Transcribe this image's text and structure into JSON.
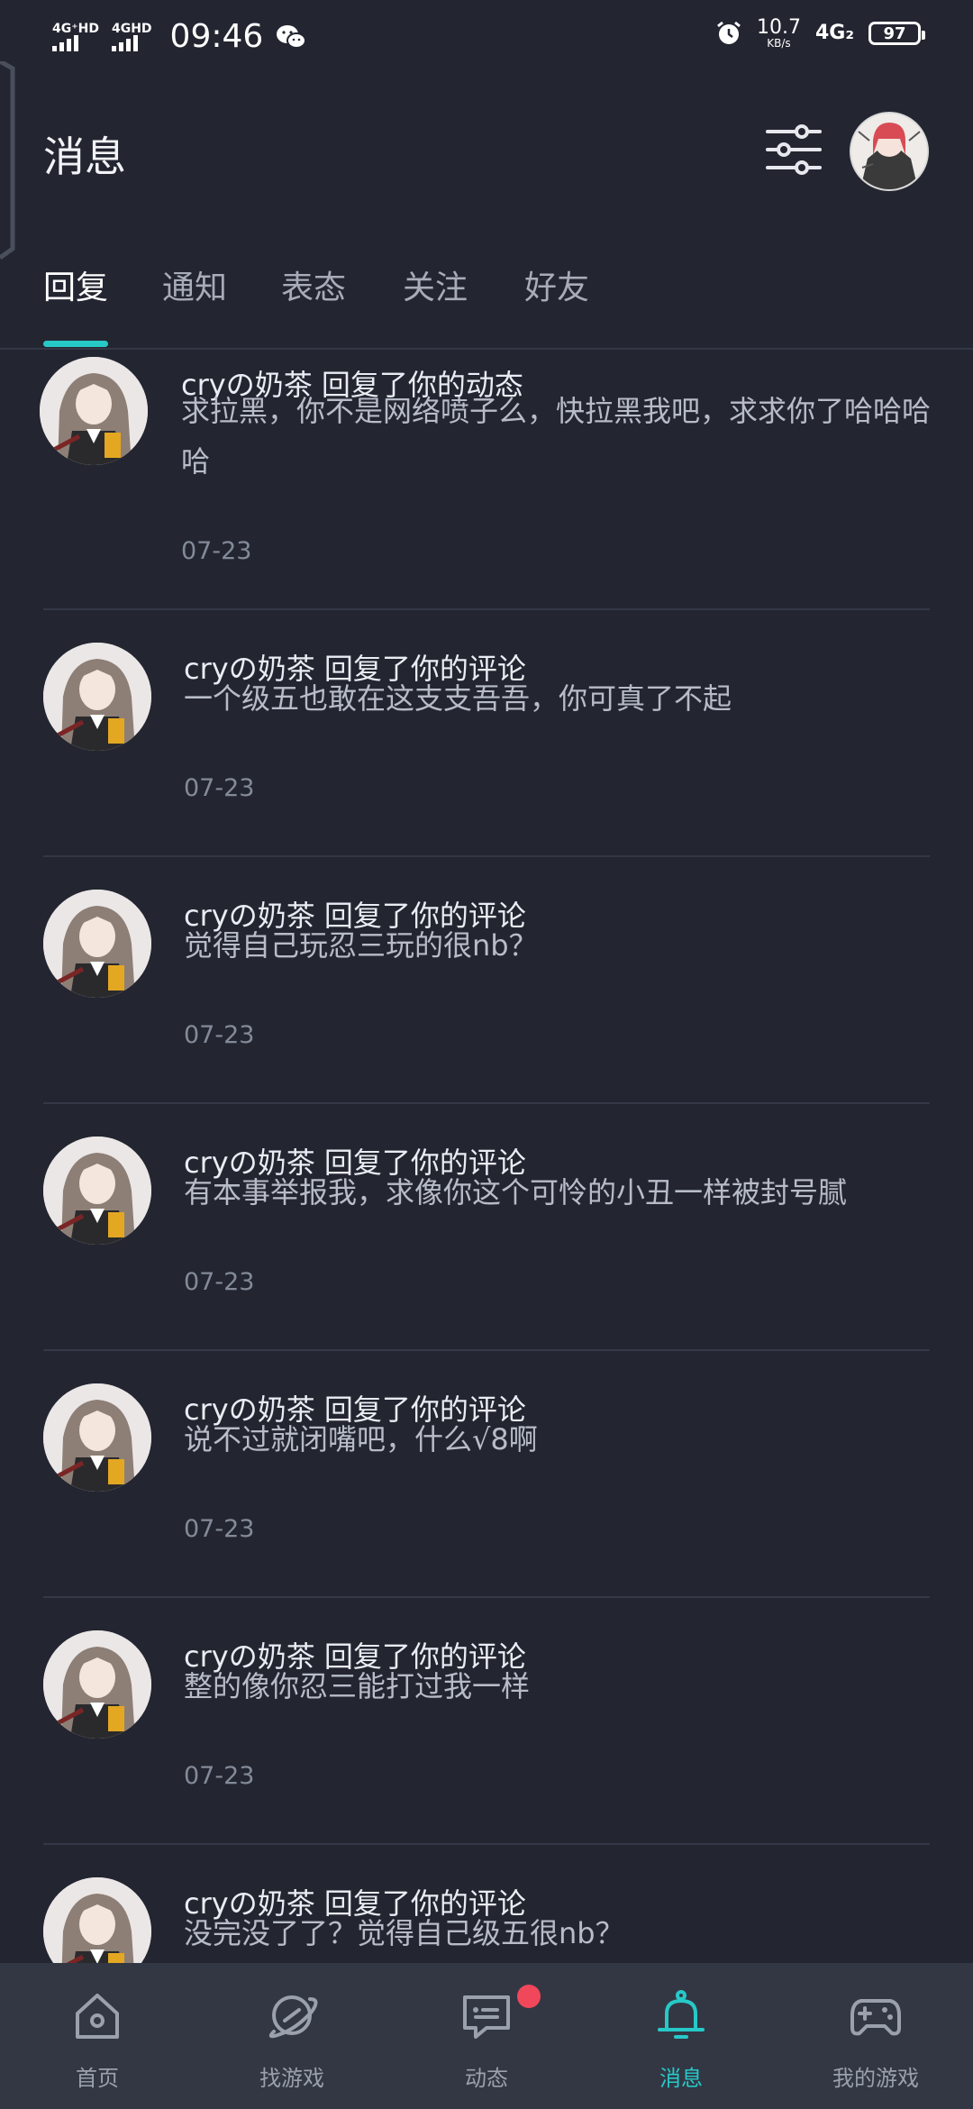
{
  "status_bar": {
    "signal1_label": "4G⁺HD",
    "signal2_label": "4GHD",
    "time": "09:46",
    "net_speed": "10.7",
    "net_unit": "KB/s",
    "net_type": "4G₂",
    "battery": "97"
  },
  "header": {
    "title": "消息",
    "icons": [
      "filter-sliders-icon",
      "profile-avatar"
    ]
  },
  "tabs": [
    {
      "label": "回复",
      "active": true
    },
    {
      "label": "通知",
      "active": false
    },
    {
      "label": "表态",
      "active": false
    },
    {
      "label": "关注",
      "active": false
    },
    {
      "label": "好友",
      "active": false
    }
  ],
  "messages": [
    {
      "title": "cryの奶茶 回复了你的动态",
      "body": "求拉黑，你不是网络喷子么，快拉黑我吧，求求你了哈哈哈哈",
      "date": "07-23"
    },
    {
      "title": "cryの奶茶 回复了你的评论",
      "body": "一个级五也敢在这支支吾吾，你可真了不起",
      "date": "07-23"
    },
    {
      "title": "cryの奶茶 回复了你的评论",
      "body": "觉得自己玩忍三玩的很nb？",
      "date": "07-23"
    },
    {
      "title": "cryの奶茶 回复了你的评论",
      "body": "有本事举报我，求像你这个可怜的小丑一样被封号腻",
      "date": "07-23"
    },
    {
      "title": "cryの奶茶 回复了你的评论",
      "body": "说不过就闭嘴吧，什么√8啊",
      "date": "07-23"
    },
    {
      "title": "cryの奶茶 回复了你的评论",
      "body": "整的像你忍三能打过我一样",
      "date": "07-23"
    },
    {
      "title": "cryの奶茶 回复了你的评论",
      "body": "没完没了了？觉得自己级五很nb？",
      "date": ""
    }
  ],
  "bottom_nav": [
    {
      "label": "首页",
      "icon": "home-icon",
      "active": false
    },
    {
      "label": "找游戏",
      "icon": "planet-icon",
      "active": false
    },
    {
      "label": "动态",
      "icon": "chat-bubble-icon",
      "active": false,
      "badge": true
    },
    {
      "label": "消息",
      "icon": "bell-icon",
      "active": true
    },
    {
      "label": "我的游戏",
      "icon": "gamepad-icon",
      "active": false
    }
  ],
  "colors": {
    "background": "#232631",
    "accent": "#27c9c7",
    "nav_background": "#333744",
    "badge": "#f0485a"
  }
}
